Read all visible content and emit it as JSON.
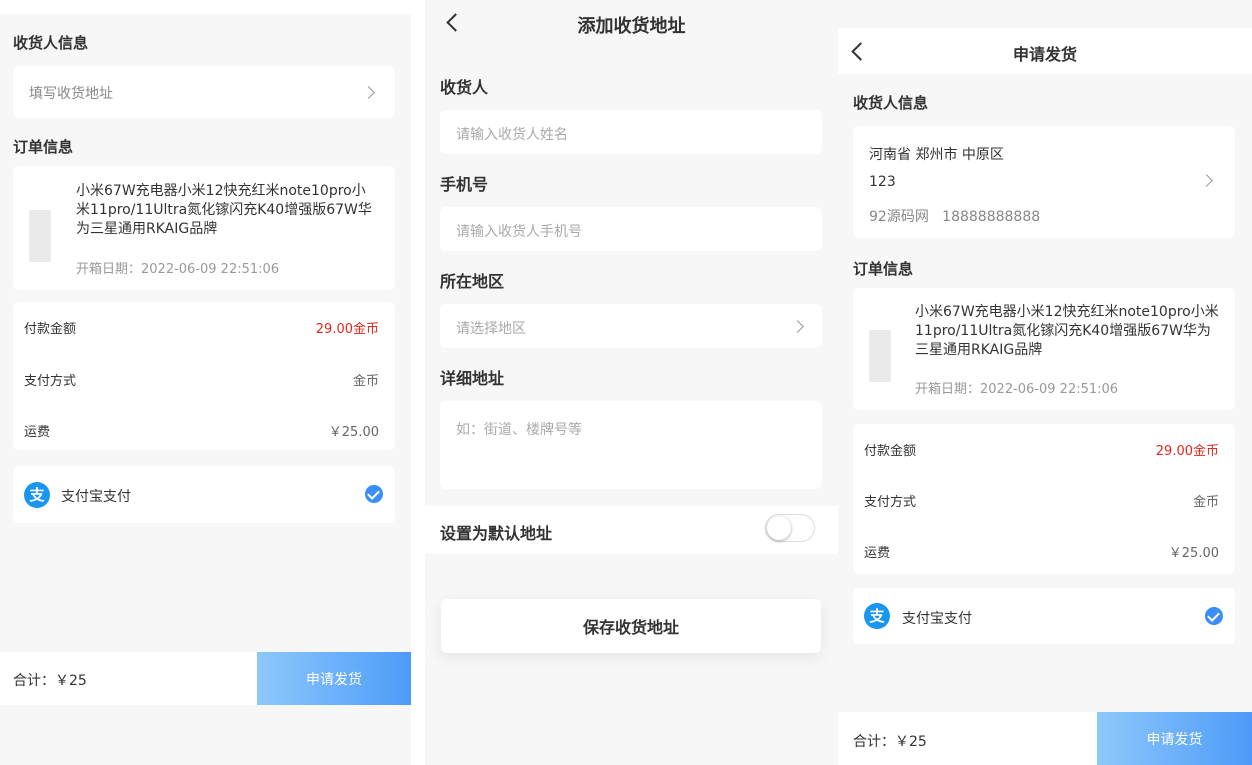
{
  "screen_left": {
    "receiver_section": "收货人信息",
    "address_placeholder": "填写收货地址",
    "order_section": "订单信息",
    "product_title": "小米67W充电器小米12快充红米note10pro小米11pro/11Ultra氮化镓闪充K40增强版67W华为三星通用RKAIG品牌",
    "open_date": "开箱日期：2022-06-09 22:51:06",
    "rows": [
      {
        "label": "付款金额",
        "value": "29.00金币"
      },
      {
        "label": "支付方式",
        "value": "金币"
      },
      {
        "label": "运费",
        "value": "￥25.00"
      }
    ],
    "payment_icon": "支",
    "payment_label": "支付宝支付",
    "total": "合计：￥25",
    "submit": "申请发货"
  },
  "screen_middle": {
    "title": "添加收货地址",
    "fields": [
      {
        "label": "收货人",
        "placeholder": "请输入收货人姓名"
      },
      {
        "label": "手机号",
        "placeholder": "请输入收货人手机号"
      },
      {
        "label": "所在地区",
        "placeholder": "请选择地区"
      },
      {
        "label": "详细地址",
        "placeholder": "如：街道、楼牌号等"
      }
    ],
    "default_label": "设置为默认地址",
    "save": "保存收货地址"
  },
  "screen_right": {
    "title": "申请发货",
    "receiver_section": "收货人信息",
    "address_region": "河南省 郑州市 中原区",
    "address_detail": "123",
    "contact": "92源码网   18888888888",
    "order_section": "订单信息",
    "product_title": "小米67W充电器小米12快充红米note10pro小米11pro/11Ultra氮化镓闪充K40增强版67W华为三星通用RKAIG品牌",
    "open_date": "开箱日期：2022-06-09 22:51:06",
    "rows": [
      {
        "label": "付款金额",
        "value": "29.00金币"
      },
      {
        "label": "支付方式",
        "value": "金币"
      },
      {
        "label": "运费",
        "value": "￥25.00"
      }
    ],
    "payment_icon": "支",
    "payment_label": "支付宝支付",
    "total": "合计：￥25",
    "submit": "申请发货"
  },
  "colors": {
    "accent": "#4d9bf8",
    "price": "#e0281e",
    "alipay": "#1a96f0"
  }
}
